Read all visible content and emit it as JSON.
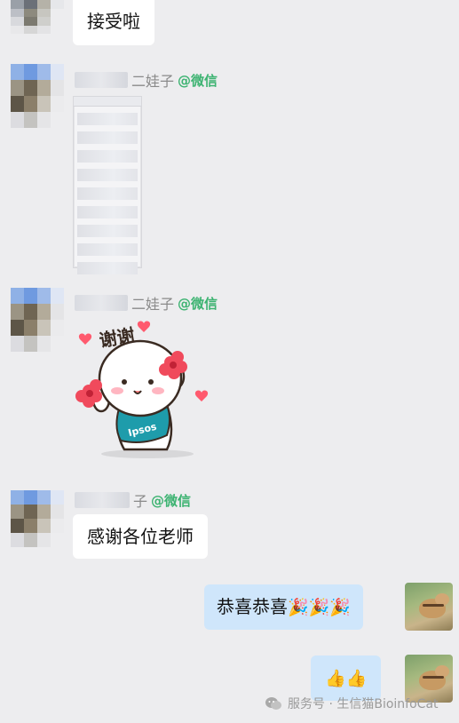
{
  "messages": [
    {
      "sender_name_suffix": "",
      "text": "接受啦"
    },
    {
      "sender_name_suffix": "二娃子",
      "wechat_tag": "@微信"
    },
    {
      "sender_name_suffix": "二娃子",
      "wechat_tag": "@微信",
      "sticker_text": "谢谢",
      "sticker_shirt_text": "Ipsos"
    },
    {
      "sender_name_suffix": "子",
      "wechat_tag": "@微信",
      "text": "感谢各位老师"
    }
  ],
  "my_messages": [
    {
      "text": "恭喜恭喜",
      "emojis": "🎉🎉🎉"
    },
    {
      "emojis": "👍👍"
    }
  ],
  "watermark": {
    "text": "服务号 · 生信猫BioinfoCat",
    "icon": "wechat-icon"
  },
  "colors": {
    "wechat_tag": "#3cb371",
    "my_bubble": "#cfe6fb",
    "bg": "#ededef"
  }
}
